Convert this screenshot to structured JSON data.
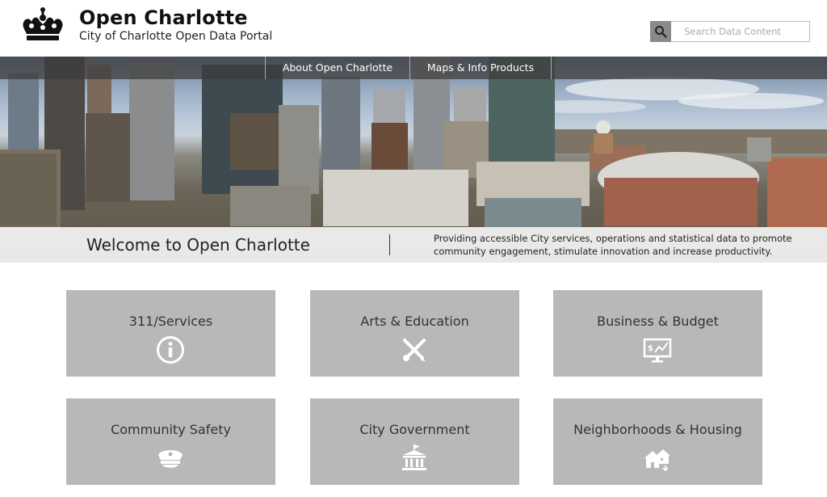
{
  "header": {
    "title": "Open Charlotte",
    "subtitle": "City of Charlotte Open Data Portal",
    "logo_icon": "crown-icon"
  },
  "search": {
    "placeholder": "Search Data Content",
    "icon": "search-icon"
  },
  "nav": {
    "items": [
      {
        "label": "About Open Charlotte"
      },
      {
        "label": "Maps & Info Products"
      }
    ]
  },
  "hero": {
    "welcome": "Welcome to Open Charlotte",
    "description": "Providing accessible City services, operations and statistical data to promote community engagement, stimulate innovation and increase productivity."
  },
  "tiles": [
    {
      "label": "311/Services",
      "icon": "info-icon"
    },
    {
      "label": "Arts & Education",
      "icon": "pencil-brush-icon"
    },
    {
      "label": "Business & Budget",
      "icon": "monitor-chart-icon"
    },
    {
      "label": "Community Safety",
      "icon": "police-cap-icon"
    },
    {
      "label": "City Government",
      "icon": "government-building-icon"
    },
    {
      "label": "Neighborhoods & Housing",
      "icon": "houses-icon"
    }
  ],
  "colors": {
    "tile_bg": "#b8b8b8",
    "nav_bg": "#3c3c3c",
    "search_button": "#8a8a8a"
  }
}
